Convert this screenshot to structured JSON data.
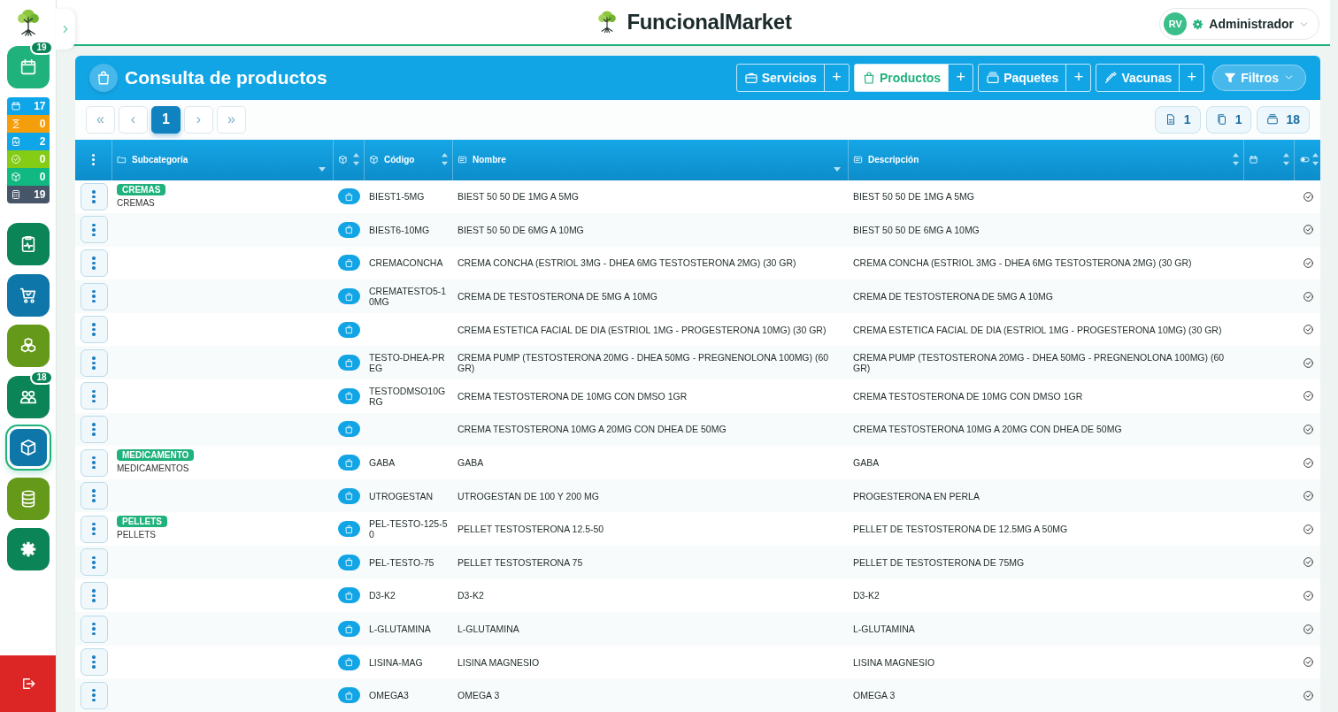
{
  "header": {
    "brand": "FuncionalMarket",
    "user": {
      "initials": "RV",
      "role": "Administrador"
    }
  },
  "sidebar": {
    "top_button": {
      "kind": "calendar",
      "badge": "19",
      "color": "#20b27c"
    },
    "stats": [
      {
        "kind": "calendar",
        "value": "17",
        "color": "#0ea5e9"
      },
      {
        "kind": "hourglass",
        "value": "0",
        "color": "#f59e0b"
      },
      {
        "kind": "clipboard",
        "value": "2",
        "color": "#0ea5e9"
      },
      {
        "kind": "check",
        "value": "0",
        "color": "#84cc16"
      },
      {
        "kind": "box",
        "value": "0",
        "color": "#10b981"
      },
      {
        "kind": "calculator",
        "value": "19",
        "color": "#475569"
      }
    ],
    "nav": [
      {
        "kind": "clipboard",
        "color": "#0b8457",
        "selected": false
      },
      {
        "kind": "cart",
        "color": "#0e76a8",
        "selected": false
      },
      {
        "kind": "cubes",
        "color": "#65991a",
        "selected": false
      },
      {
        "kind": "users",
        "color": "#0b8457",
        "selected": false,
        "badge": "18"
      },
      {
        "kind": "box",
        "color": "#0e76a8",
        "selected": true
      },
      {
        "kind": "database",
        "color": "#65991a",
        "selected": false
      },
      {
        "kind": "gear",
        "color": "#0b8457",
        "selected": false
      }
    ]
  },
  "panel": {
    "title": "Consulta de productos",
    "tabs": [
      {
        "label": "Servicios",
        "kind": "briefcase",
        "selected": false,
        "add": "+"
      },
      {
        "label": "Productos",
        "kind": "bag",
        "selected": true,
        "add": "+"
      },
      {
        "label": "Paquetes",
        "kind": "tray",
        "selected": false,
        "add": "+"
      },
      {
        "label": "Vacunas",
        "kind": "syringe",
        "selected": false,
        "add": "+"
      }
    ],
    "filter": "Filtros",
    "pagination": [
      {
        "label": "«",
        "selected": false
      },
      {
        "label": "‹",
        "selected": false
      },
      {
        "label": "1",
        "selected": true
      },
      {
        "label": "›",
        "selected": false
      },
      {
        "label": "»",
        "selected": false
      }
    ],
    "counters": [
      {
        "kind": "doc",
        "value": "1"
      },
      {
        "kind": "copy",
        "value": "1"
      },
      {
        "kind": "tray",
        "value": "18"
      }
    ]
  },
  "table": {
    "columns": [
      "Subcategoría",
      "Código",
      "Nombre",
      "Descripción"
    ],
    "rows": [
      {
        "tag": "CREMAS",
        "subcategory": "CREMAS",
        "code": "BIEST1-5MG",
        "name": "BIEST 50 50 DE 1MG A 5MG",
        "description": "BIEST 50 50 DE 1MG A 5MG"
      },
      {
        "code": "BIEST6-10MG",
        "name": "BIEST 50 50 DE 6MG A 10MG",
        "description": "BIEST 50 50 DE 6MG A 10MG"
      },
      {
        "code": "CREMACONCHA",
        "name": "CREMA CONCHA (ESTRIOL 3MG - DHEA 6MG TESTOSTERONA 2MG) (30 GR)",
        "description": "CREMA CONCHA (ESTRIOL 3MG - DHEA 6MG TESTOSTERONA 2MG) (30 GR)"
      },
      {
        "code": "CREMATESTO5-10MG",
        "name": "CREMA DE TESTOSTERONA DE 5MG A 10MG",
        "description": "CREMA DE TESTOSTERONA DE 5MG A 10MG"
      },
      {
        "name": "CREMA ESTETICA FACIAL DE DIA (ESTRIOL 1MG - PROGESTERONA 10MG) (30 GR)",
        "description": "CREMA ESTETICA FACIAL DE DIA (ESTRIOL 1MG - PROGESTERONA 10MG) (30 GR)"
      },
      {
        "code": "TESTO-DHEA-PREG",
        "name": "CREMA PUMP (TESTOSTERONA 20MG - DHEA 50MG - PREGNENOLONA 100MG) (60 GR)",
        "description": "CREMA PUMP (TESTOSTERONA 20MG - DHEA 50MG - PREGNENOLONA 100MG) (60 GR)"
      },
      {
        "code": "TESTODMSO10GRG",
        "name": "CREMA TESTOSTERONA DE 10MG CON DMSO 1GR",
        "description": "CREMA TESTOSTERONA DE 10MG CON DMSO 1GR"
      },
      {
        "name": "CREMA TESTOSTERONA 10MG A 20MG CON DHEA DE 50MG",
        "description": "CREMA TESTOSTERONA 10MG A 20MG CON DHEA DE 50MG"
      },
      {
        "tag": "MEDICAMENTO",
        "subcategory": "MEDICAMENTOS",
        "code": "GABA",
        "name": "GABA",
        "description": "GABA"
      },
      {
        "code": "UTROGESTAN",
        "name": "UTROGESTAN DE 100 Y 200 MG",
        "description": "PROGESTERONA EN PERLA"
      },
      {
        "tag": "PELLETS",
        "subcategory": "PELLETS",
        "code": "PEL-TESTO-125-50",
        "name": "PELLET TESTOSTERONA 12.5-50",
        "description": "PELLET DE TESTOSTERONA DE 12.5MG A 50MG"
      },
      {
        "code": "PEL-TESTO-75",
        "name": "PELLET TESTOSTERONA 75",
        "description": "PELLET DE TESTOSTERONA DE 75MG"
      },
      {
        "code": "D3-K2",
        "name": "D3-K2",
        "description": "D3-K2"
      },
      {
        "code": "L-GLUTAMINA",
        "name": "L-GLUTAMINA",
        "description": "L-GLUTAMINA"
      },
      {
        "code": "LISINA-MAG",
        "name": "LISINA MAGNESIO",
        "description": "LISINA MAGNESIO"
      },
      {
        "code": "OMEGA3",
        "name": "OMEGA 3",
        "description": "OMEGA 3"
      }
    ]
  }
}
